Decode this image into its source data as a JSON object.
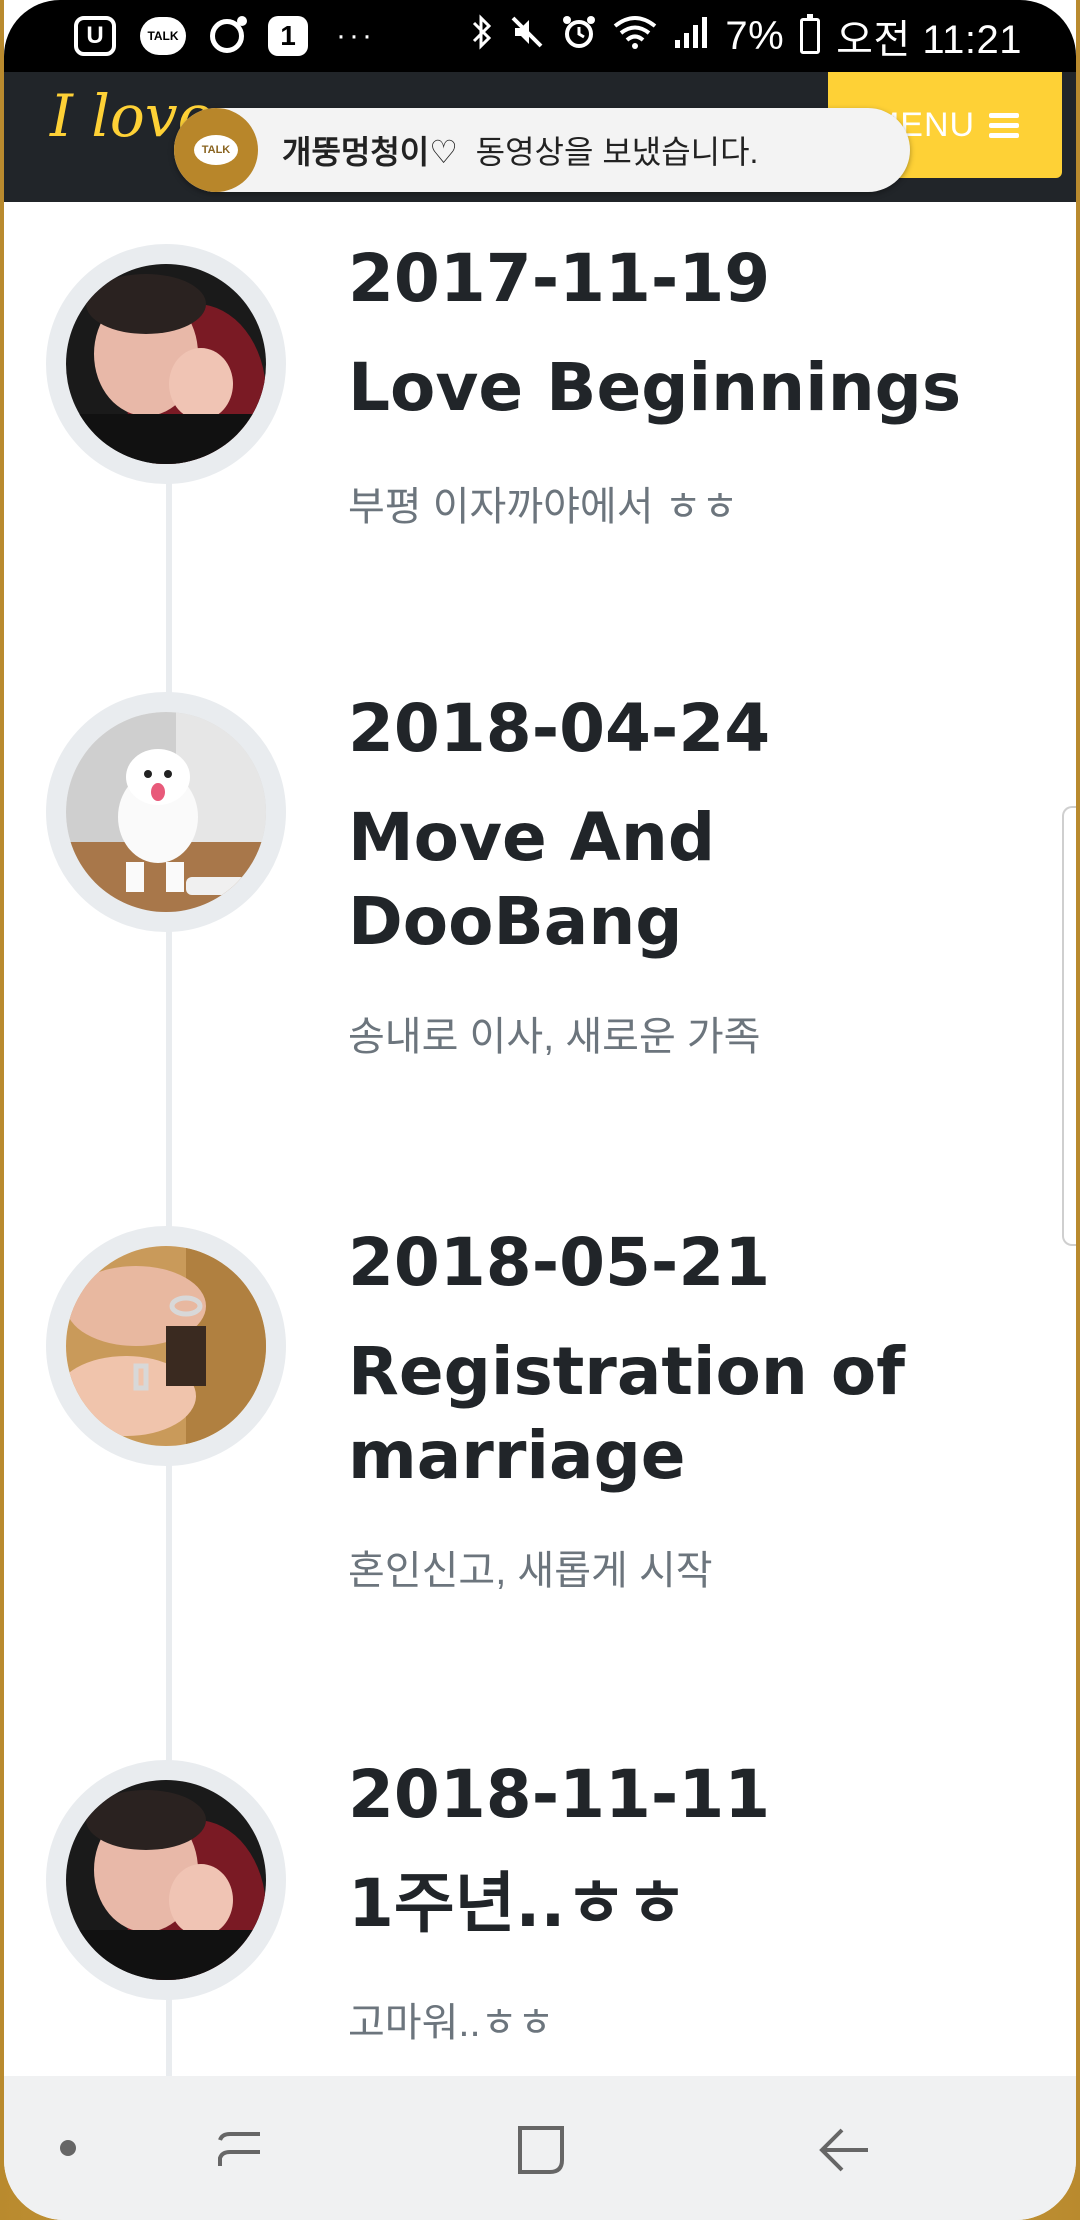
{
  "status_bar": {
    "icons": [
      "u-plus-icon",
      "kakaotalk-icon",
      "camera-app-icon",
      "one-icon",
      "more-dots-icon",
      "bluetooth-icon",
      "mute-icon",
      "alarm-icon",
      "wifi-icon",
      "signal-icon",
      "battery-icon"
    ],
    "talk_badge": "TALK",
    "one_badge": "1",
    "more": "···",
    "battery": "7%",
    "time": "오전 11:21"
  },
  "header": {
    "logo": "I love",
    "menu_label": "MENU"
  },
  "toast": {
    "app_badge": "TALK",
    "sender": "개뚱멍청이♡",
    "message": "동영상을 보냈습니다."
  },
  "timeline": [
    {
      "date": "2017-11-19",
      "title": "Love Beginnings",
      "subtitle": "부평 이자까야에서 ㅎㅎ",
      "photo": "couple-photo"
    },
    {
      "date": "2018-04-24",
      "title": "Move And DooBang",
      "subtitle": "송내로 이사, 새로운 가족",
      "photo": "puppy-photo"
    },
    {
      "date": "2018-05-21",
      "title": "Registration of marriage",
      "subtitle": "혼인신고, 새롭게 시작",
      "photo": "rings-photo"
    },
    {
      "date": "2018-11-11",
      "title": "1주년..ㅎㅎ",
      "subtitle": "고마워..ㅎㅎ",
      "photo": "couple-photo"
    }
  ],
  "colors": {
    "accent": "#fed136",
    "header_bg": "#212529",
    "text": "#212529",
    "muted": "#6c757d",
    "timeline": "#e9ecef"
  }
}
